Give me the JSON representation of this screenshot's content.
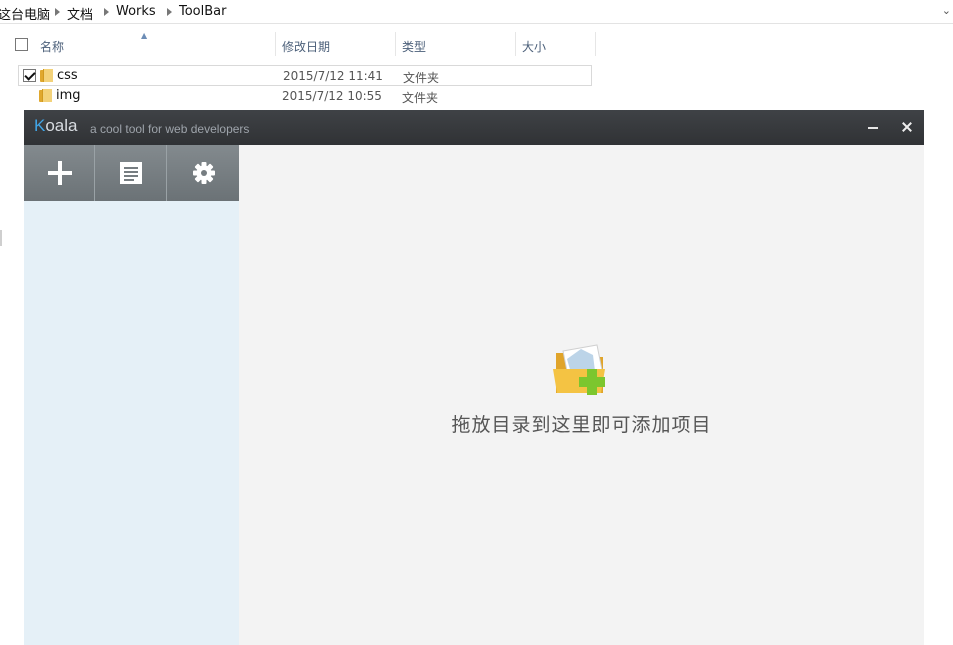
{
  "explorer": {
    "breadcrumb": [
      "这台电脑",
      "文档",
      "Works",
      "ToolBar"
    ],
    "columns": {
      "name": "名称",
      "modified": "修改日期",
      "type": "类型",
      "size": "大小"
    },
    "rows": [
      {
        "name": "css",
        "modified": "2015/7/12 11:41",
        "type": "文件夹",
        "checked": true
      },
      {
        "name": "img",
        "modified": "2015/7/12 10:55",
        "type": "文件夹",
        "checked": false
      }
    ],
    "icons": {
      "folder": "folder-icon",
      "dropdown": "chevron-down-icon"
    }
  },
  "koala": {
    "logo_k": "K",
    "logo_rest": "oala",
    "tagline": "a cool tool for web developers",
    "toolbar_icons": [
      "plus-icon",
      "document-icon",
      "gear-icon"
    ],
    "drop_text": "拖放目录到这里即可添加项目",
    "colors": {
      "titlebar": "#333538",
      "accent": "#41a5e6",
      "sidebar": "#e5f0f7",
      "toolbar": "#767d81",
      "main": "#f3f3f3",
      "plus_green": "#7cc62e"
    }
  }
}
